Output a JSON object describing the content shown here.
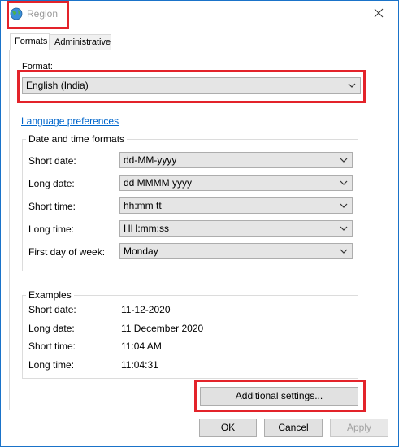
{
  "window": {
    "title": "Region"
  },
  "tabs": [
    {
      "label": "Formats"
    },
    {
      "label": "Administrative"
    }
  ],
  "format": {
    "label": "Format:",
    "selected": "English (India)"
  },
  "language_link": "Language preferences",
  "date_time_formats": {
    "title": "Date and time formats",
    "rows": [
      {
        "label": "Short date:",
        "value": "dd-MM-yyyy"
      },
      {
        "label": "Long date:",
        "value": "dd MMMM yyyy"
      },
      {
        "label": "Short time:",
        "value": "hh:mm tt"
      },
      {
        "label": "Long time:",
        "value": "HH:mm:ss"
      },
      {
        "label": "First day of week:",
        "value": "Monday"
      }
    ]
  },
  "examples": {
    "title": "Examples",
    "rows": [
      {
        "label": "Short date:",
        "value": "11-12-2020"
      },
      {
        "label": "Long date:",
        "value": "11 December 2020"
      },
      {
        "label": "Short time:",
        "value": "11:04 AM"
      },
      {
        "label": "Long time:",
        "value": "11:04:31"
      }
    ]
  },
  "buttons": {
    "additional": "Additional settings...",
    "ok": "OK",
    "cancel": "Cancel",
    "apply": "Apply"
  },
  "colors": {
    "highlight": "#e3232a",
    "link": "#0066cc",
    "frame": "#1a73c9"
  },
  "icons": {
    "title": "globe-icon",
    "close": "close-icon",
    "dropdown": "chevron-down-icon"
  }
}
